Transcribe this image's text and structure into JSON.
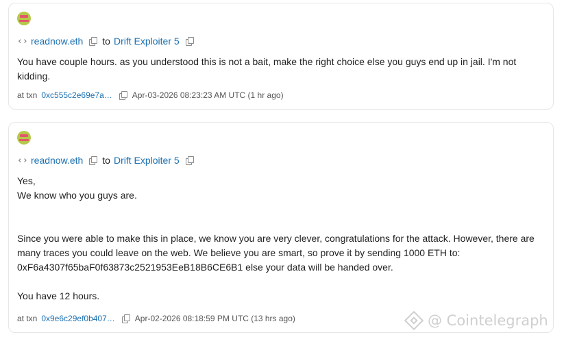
{
  "messages": [
    {
      "from": "readnow.eth",
      "to_word": "to",
      "to": "Drift Exploiter 5",
      "body": [
        "You have couple hours. as you understood this is not a bait, make the right choice else you guys end up in jail. I'm not kidding."
      ],
      "txn_label": "at txn",
      "txn_hash": "0xc555c2e69e7a…",
      "timestamp": "Apr-03-2026 08:23:23 AM UTC (1 hr ago)"
    },
    {
      "from": "readnow.eth",
      "to_word": "to",
      "to": "Drift Exploiter 5",
      "body": [
        "Yes,",
        "We know who you guys are.",
        "Since you were able to make this in place, we know you are very clever, congratulations for the attack. However, there are many traces you could leave on the web. We believe you are smart, so prove it by sending 1000 ETH to: 0xF6a4307f65baF0f63873c2521953EeB18B6CE6B1 else your data will be handed over.",
        "You have 12 hours."
      ],
      "txn_label": "at txn",
      "txn_hash": "0x9e6c29ef0b407…",
      "timestamp": "Apr-02-2026 08:18:59 PM UTC (13 hrs ago)"
    }
  ],
  "icons": {
    "code": "code-brackets-icon",
    "copy": "copy-icon",
    "avatar": "identicon-avatar"
  },
  "colors": {
    "link": "#1a6fb0",
    "text": "#1f1f1f",
    "border": "#e6e6e6"
  },
  "watermark": "@ Cointelegraph"
}
